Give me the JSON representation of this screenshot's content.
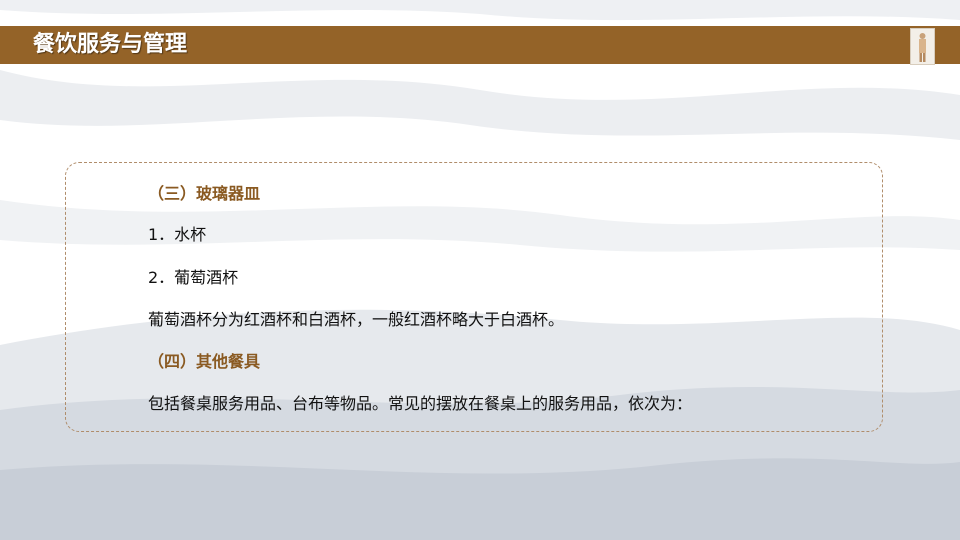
{
  "header": {
    "title": "餐饮服务与管理",
    "accent_color": "#946328"
  },
  "content": {
    "section3_heading": "（三）玻璃器皿",
    "item1": "1．水杯",
    "item2": "2．葡萄酒杯",
    "wine_desc": "葡萄酒杯分为红酒杯和白酒杯，一般红酒杯略大于白酒杯。",
    "section4_heading": "（四）其他餐具",
    "other_desc": "包括餐桌服务用品、台布等物品。常见的摆放在餐桌上的服务用品，依次为："
  }
}
